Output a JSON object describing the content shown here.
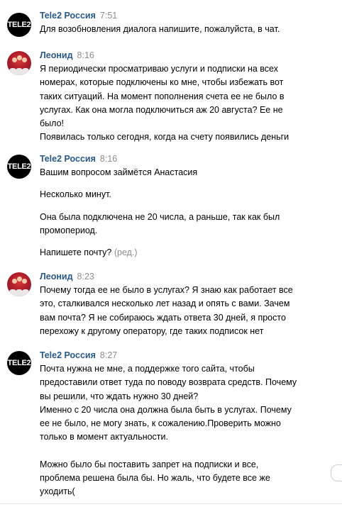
{
  "messages": [
    {
      "author": "Tele2 Россия",
      "time": "7:51",
      "avatar_label": "TELE2",
      "lines": [
        "Для возобновления диалога напишите, пожалуйста, в чат."
      ]
    },
    {
      "author": "Леонид",
      "time": "8:16",
      "lines": [
        "Я периодически просматриваю услуги и подписки на всех",
        "номерах, которые подключены ко мне, чтобы избежать вот",
        "таких ситуаций. На момент пополнения счета ее не было в",
        "услугах. Как она могла подключиться аж 20 августа? Ее не",
        "было!",
        "Появилась только сегодня, когда на счету появились деньги"
      ]
    },
    {
      "author": "Tele2 Россия",
      "time": "8:16",
      "avatar_label": "TELE2",
      "paragraphs": [
        [
          "Вашим вопросом займётся Анастасия"
        ],
        [
          "Несколько минут."
        ],
        [
          "Она была подключена не 20 числа, а раньше, так как был",
          "промопериод."
        ],
        [
          "Напишете почту?"
        ]
      ],
      "edited_label": "(ред.)"
    },
    {
      "author": "Леонид",
      "time": "8:23",
      "lines": [
        "Почему тогда ее не было в услугах? Я знаю как работает все",
        "это, сталкивался несколько лет назад и опять с вами. Зачем",
        "вам почта? Я не собираюсь ждать ответа 30 дней, я просто",
        "перехожу к другому оператору, где таких подписок нет"
      ]
    },
    {
      "author": "Tele2 Россия",
      "time": "8:27",
      "avatar_label": "TELE2",
      "paragraphs": [
        [
          "Почта нужна не мне, а поддержке того сайта, чтобы",
          "предоставили ответ туда по поводу возврата средств. Почему",
          "вы решили, что ждать нужно 30 дней?",
          "Именно с 20 числа она должна была быть в услугах. Почему",
          "ее не было, не могу знать, к сожалению.Проверить можно",
          "только в момент актуальности."
        ],
        [
          "Можно было бы поставить запрет на подписки и все,",
          "проблема решена была бы. Но жаль, что будете все же",
          "уходить("
        ]
      ]
    }
  ]
}
